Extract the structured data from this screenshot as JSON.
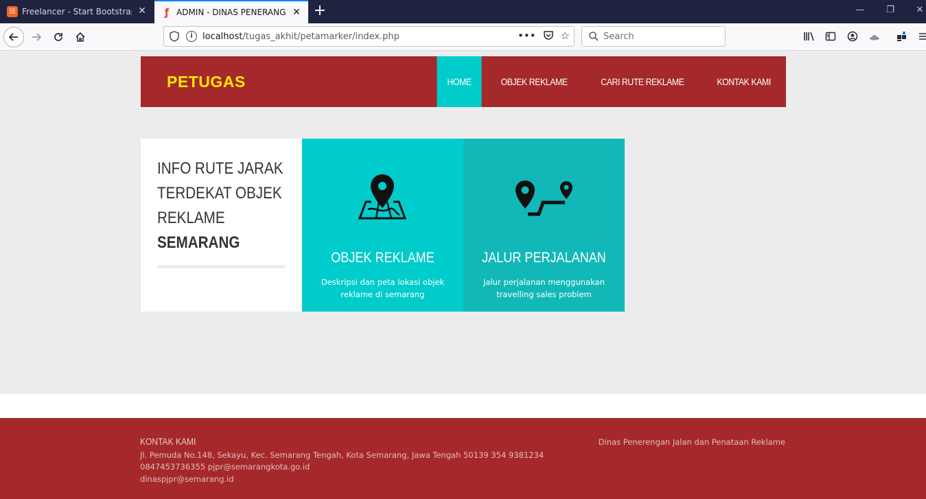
{
  "browser": {
    "tabs": [
      {
        "title": "Freelancer - Start Bootstrap Theme",
        "favicon": "xampp-icon",
        "active": false
      },
      {
        "title": "ADMIN - DINAS PENERANGAN JALAN",
        "favicon": "codeigniter-icon",
        "active": true
      }
    ],
    "url_host": "localhost",
    "url_path": "/tugas_akhit/petamarker/index.php",
    "search_placeholder": "Search"
  },
  "header": {
    "brand": "PETUGAS",
    "menu": [
      "HOME",
      "OBJEK REKLAME",
      "CARI RUTE REKLAME",
      "KONTAK KAMI"
    ],
    "active_menu": "HOME"
  },
  "intro": {
    "line1": "INFO RUTE JARAK",
    "line2": "TERDEKAT OBJEK",
    "line3": "REKLAME",
    "line4": "SEMARANG"
  },
  "cards": [
    {
      "title": "OBJEK REKLAME",
      "desc": "Deskripsi dan peta lokasi objek reklame di semarang",
      "icon": "map-location-icon",
      "color": "#00cccc"
    },
    {
      "title": "JALUR PERJALANAN",
      "desc": "Jalur perjalanan menggunakan travelling sales problem",
      "icon": "route-icon",
      "color": "#12b8b8"
    }
  ],
  "footer": {
    "title": "KONTAK KAMI",
    "address": "Jl. Pemuda No.148, Sekayu, Kec. Semarang Tengah, Kota Semarang, Jawa Tengah 50139 354 9381234",
    "phone_email": "0847453736355 pjpr@semarangkota.go.id",
    "email": "dinaspjpr@semarang.id",
    "right_text": "Dinas Penerengan Jalan dan Penataan Reklame"
  },
  "colors": {
    "header_bg": "#a5292a",
    "brand": "#ffe600",
    "accent": "#00cccc",
    "accent_dark": "#12b8b8",
    "page_bg": "#ececec"
  }
}
